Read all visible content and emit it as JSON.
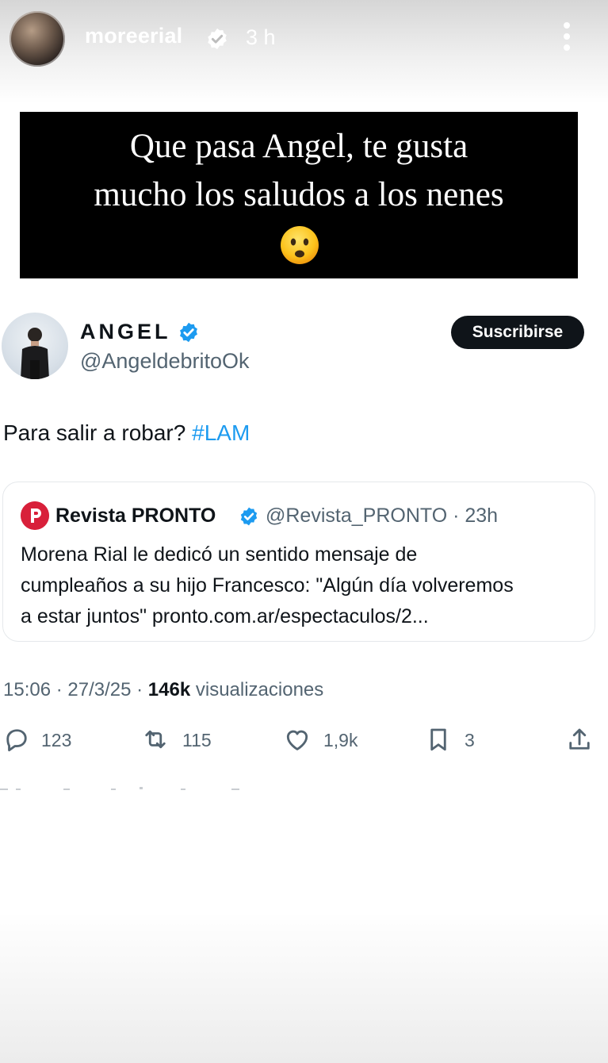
{
  "story": {
    "username": "moreerial",
    "time": "3 h"
  },
  "caption": {
    "line1": "Que pasa Angel, te gusta",
    "line2": "mucho los saludos a los nenes",
    "emoji": "😦"
  },
  "tweet": {
    "name": "ANGEL",
    "handle": "@AngeldebritoOk",
    "subscribe_label": "Suscribirse",
    "text": "Para salir a robar?",
    "hashtag": "#LAM",
    "quote": {
      "name": "Revista PRONTO",
      "handle": "@Revista_PRONTO · 23h",
      "body_lines": [
        "Morena Rial le dedicó un sentido mensaje de",
        "cumpleaños a su hijo Francesco: \"Algún día volveremos",
        "a estar juntos\"  pronto.com.ar/espectaculos/2..."
      ]
    },
    "meta": {
      "time": "15:06 · 27/3/25 · ",
      "views_count": "146k",
      "views_label": " visualizaciones"
    },
    "actions": {
      "replies": "123",
      "retweets": "115",
      "likes": "1,9k",
      "bookmarks": "3"
    }
  },
  "colors": {
    "accent": "#1d9bf0",
    "text": "#0f1419",
    "muted": "#536471",
    "pronto_red": "#d8203a"
  },
  "icons": [
    "verified-badge-icon",
    "more-vertical-icon",
    "reply-icon",
    "retweet-icon",
    "like-icon",
    "bookmark-icon",
    "share-icon",
    "pronto-logo-icon"
  ]
}
